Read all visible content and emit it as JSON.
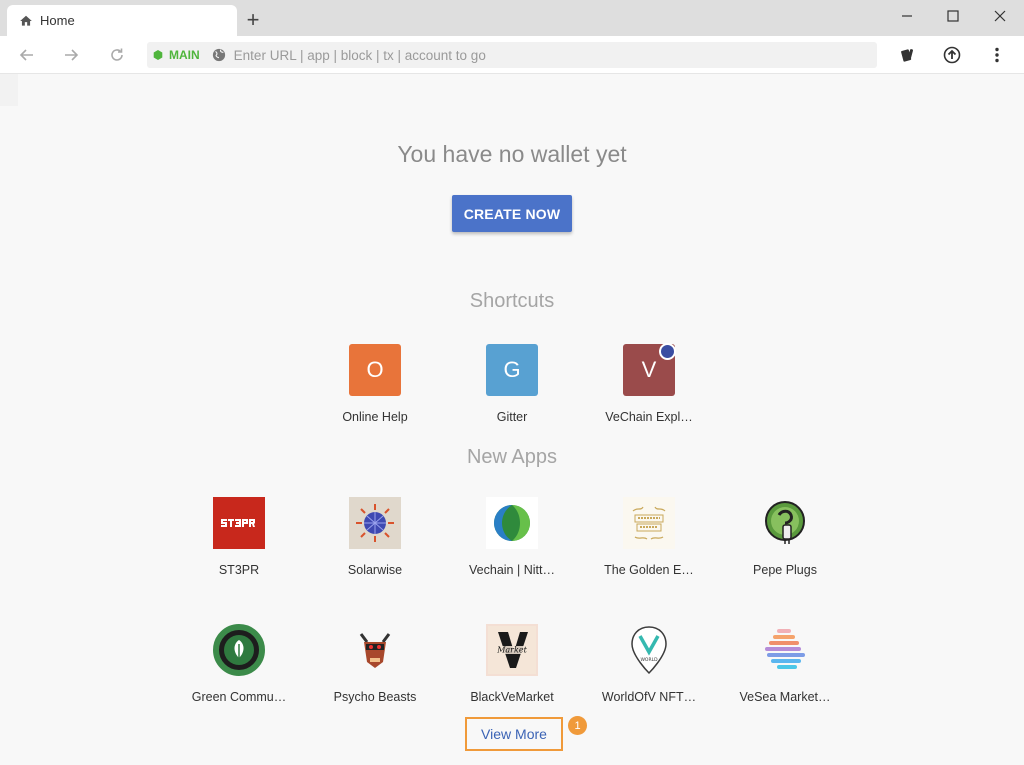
{
  "tab": {
    "title": "Home",
    "new_tab_glyph": "+"
  },
  "toolbar": {
    "network_label": "MAIN",
    "url_placeholder": "Enter URL | app | block | tx | account to go"
  },
  "main": {
    "headline": "You have no wallet yet",
    "create_button": "CREATE NOW",
    "shortcuts_title": "Shortcuts",
    "shortcuts": [
      {
        "letter": "O",
        "label": "Online Help",
        "color": "#e8743a"
      },
      {
        "letter": "G",
        "label": "Gitter",
        "color": "#58a1d2"
      },
      {
        "letter": "V",
        "label": "VeChain Expl…",
        "color": "#9a4b4b"
      }
    ],
    "new_apps_title": "New Apps",
    "apps_row1": [
      {
        "label": "ST3PR",
        "icon": "st3pr-logo"
      },
      {
        "label": "Solarwise",
        "icon": "solarwise-logo"
      },
      {
        "label": "Vechain | Nitt…",
        "icon": "nitt-logo"
      },
      {
        "label": "The Golden E…",
        "icon": "golden-empire-logo"
      },
      {
        "label": "Pepe Plugs",
        "icon": "pepe-plugs-logo"
      }
    ],
    "apps_row2": [
      {
        "label": "Green Commu…",
        "icon": "green-commuter-logo"
      },
      {
        "label": "Psycho Beasts",
        "icon": "psycho-beasts-logo"
      },
      {
        "label": "BlackVeMarket",
        "icon": "blackvemarket-logo"
      },
      {
        "label": "WorldOfV NFT…",
        "icon": "worldofv-logo"
      },
      {
        "label": "VeSea Market…",
        "icon": "vesea-logo"
      }
    ],
    "view_more": "View More",
    "annotation_number": "1"
  },
  "colors": {
    "accent": "#4b73c9",
    "network_green": "#4fb53c",
    "annotation_orange": "#f09a3a"
  }
}
